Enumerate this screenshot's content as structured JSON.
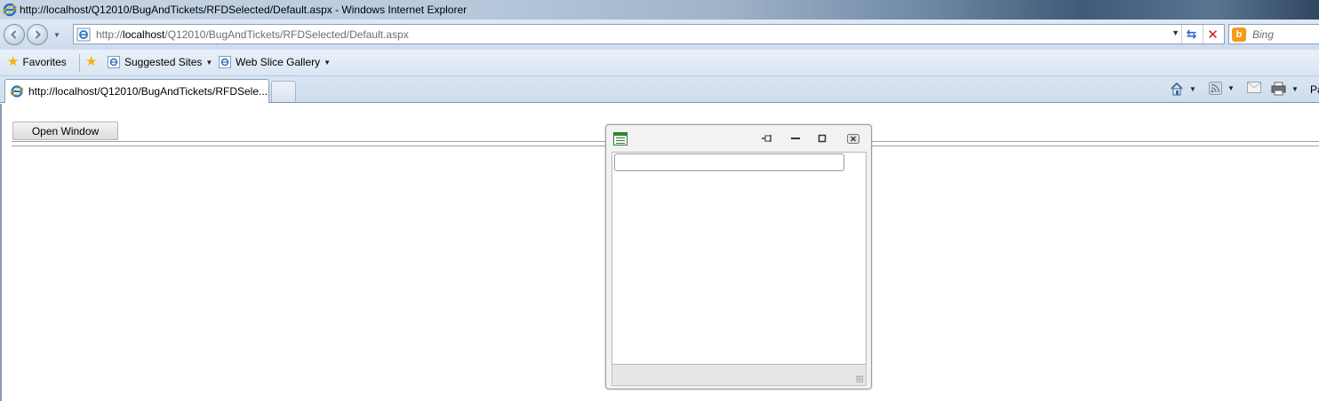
{
  "window": {
    "title": "http://localhost/Q12010/BugAndTickets/RFDSelected/Default.aspx - Windows Internet Explorer"
  },
  "address_bar": {
    "url_prefix": "http://",
    "url_host": "localhost",
    "url_path": "/Q12010/BugAndTickets/RFDSelected/Default.aspx"
  },
  "search": {
    "placeholder": "Bing",
    "provider_icon": "bing-icon"
  },
  "favorites_bar": {
    "favorites_label": "Favorites",
    "items": [
      {
        "label": "Suggested Sites"
      },
      {
        "label": "Web Slice Gallery"
      }
    ]
  },
  "tabs": [
    {
      "label": "http://localhost/Q12010/BugAndTickets/RFDSele...",
      "active": true
    }
  ],
  "command_bar": {
    "truncated_label": "Pa"
  },
  "page": {
    "open_window_button": "Open Window"
  },
  "popup_window": {
    "input_value": "",
    "buttons": [
      "pin-icon",
      "minimize-icon",
      "maximize-icon",
      "close-icon"
    ]
  },
  "colors": {
    "accent": "#2b6bc4",
    "stop": "#c81a1a",
    "bing": "#f39c1b",
    "popup_icon": "#2c8a2c"
  }
}
